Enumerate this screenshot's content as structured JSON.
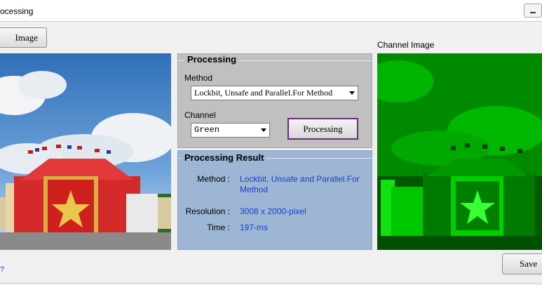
{
  "window": {
    "title": "ocessing"
  },
  "toolbar": {
    "load_label": "Image"
  },
  "channel_panel": {
    "label": "Channel Image"
  },
  "processing_group": {
    "title": "Processing",
    "method_label": "Method",
    "method_value": "Lockbit, Unsafe and Parallel.For Method",
    "channel_label": "Channel",
    "channel_value": "Green",
    "process_button": "Processing"
  },
  "result_group": {
    "title": "Processing Result",
    "method_label": "Method :",
    "method_value": "Lockbit, Unsafe and Parallel.For Method",
    "resolution_label": "Resolution :",
    "resolution_value": "3008 x 2000-pixel",
    "time_label": "Time :",
    "time_value": "197-ms"
  },
  "footer": {
    "save_label": "Save",
    "link_glyph": "?"
  },
  "colors": {
    "processing_bg": "#c0c0c0",
    "result_bg": "#9cb6d4",
    "result_value": "#1f3fcf",
    "button_border_accent": "#6c2a7c",
    "channel_tint": "#00c000"
  }
}
